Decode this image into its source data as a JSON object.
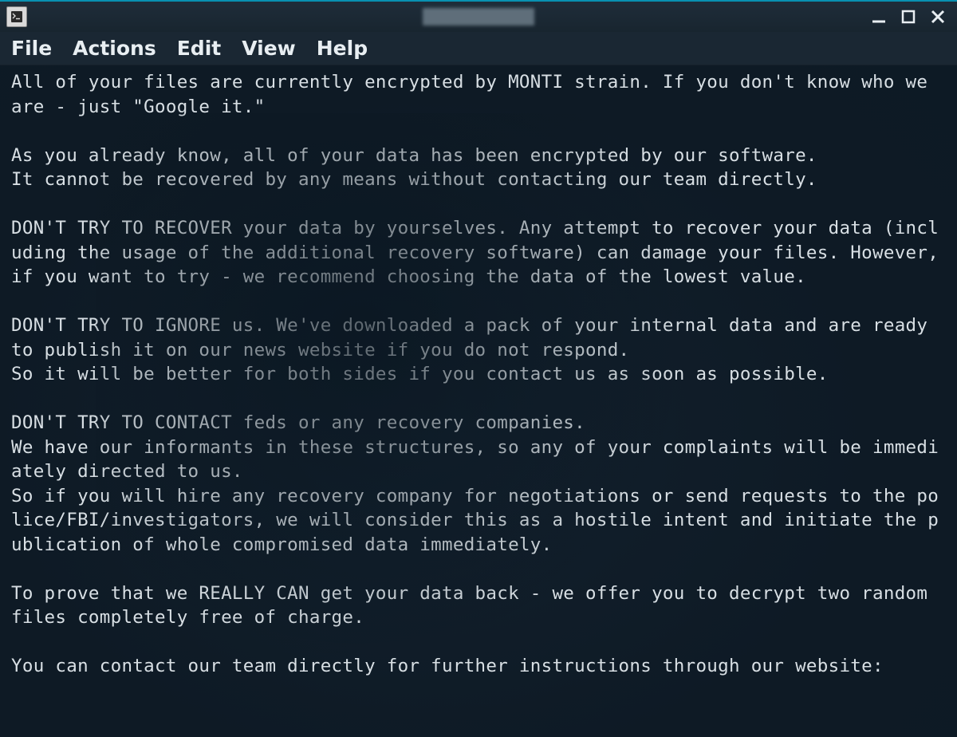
{
  "titlebar": {
    "title_obscured": true
  },
  "window_controls": {
    "minimize": "minimize",
    "maximize": "maximize",
    "close": "close"
  },
  "menubar": {
    "items": [
      "File",
      "Actions",
      "Edit",
      "View",
      "Help"
    ]
  },
  "terminal": {
    "content": "All of your files are currently encrypted by MONTI strain. If you don't know who we are - just \"Google it.\"\n\nAs you already know, all of your data has been encrypted by our software.\nIt cannot be recovered by any means without contacting our team directly.\n\nDON'T TRY TO RECOVER your data by yourselves. Any attempt to recover your data (including the usage of the additional recovery software) can damage your files. However,\nif you want to try - we recommend choosing the data of the lowest value.\n\nDON'T TRY TO IGNORE us. We've downloaded a pack of your internal data and are ready to publish it on our news website if you do not respond.\nSo it will be better for both sides if you contact us as soon as possible.\n\nDON'T TRY TO CONTACT feds or any recovery companies.\nWe have our informants in these structures, so any of your complaints will be immediately directed to us.\nSo if you will hire any recovery company for negotiations or send requests to the police/FBI/investigators, we will consider this as a hostile intent and initiate the publication of whole compromised data immediately.\n\nTo prove that we REALLY CAN get your data back - we offer you to decrypt two random files completely free of charge.\n\nYou can contact our team directly for further instructions through our website:"
  }
}
